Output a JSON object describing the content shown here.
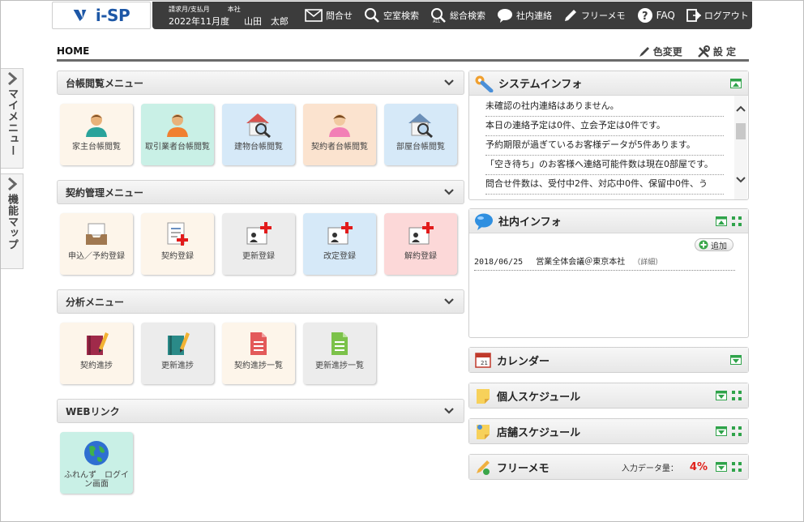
{
  "header": {
    "logo_text": "i-SP",
    "period_label": "請求月/支払月",
    "period_value": "2022年11月度",
    "branch_label": "本社",
    "user_name": "山田　太郎",
    "nav": [
      {
        "label": "問合せ",
        "icon": "mail-icon"
      },
      {
        "label": "空室検索",
        "icon": "search-icon"
      },
      {
        "label": "総合検索",
        "icon": "search-all-icon"
      },
      {
        "label": "社内連絡",
        "icon": "chat-icon"
      },
      {
        "label": "フリーメモ",
        "icon": "pencil-icon"
      },
      {
        "label": "FAQ",
        "icon": "question-icon"
      },
      {
        "label": "ログアウト",
        "icon": "logout-icon"
      }
    ]
  },
  "sidebar_tabs": [
    {
      "label": "マイメニュー"
    },
    {
      "label": "機能マップ"
    }
  ],
  "page": {
    "title": "HOME",
    "color_change": "色変更",
    "settings": "設 定"
  },
  "sections": [
    {
      "title": "台帳閲覧メニュー",
      "tiles": [
        {
          "label": "家主台帳閲覧",
          "icon": "owner-person-icon"
        },
        {
          "label": "取引業者台帳閲覧",
          "icon": "vendor-person-icon"
        },
        {
          "label": "建物台帳閲覧",
          "icon": "building-search-icon"
        },
        {
          "label": "契約者台帳閲覧",
          "icon": "tenant-person-icon"
        },
        {
          "label": "部屋台帳閲覧",
          "icon": "room-search-icon"
        }
      ]
    },
    {
      "title": "契約管理メニュー",
      "tiles": [
        {
          "label": "申込／予約登録",
          "icon": "inbox-tray-icon"
        },
        {
          "label": "契約登録",
          "icon": "document-add-icon"
        },
        {
          "label": "更新登録",
          "icon": "contract-add-icon"
        },
        {
          "label": "改定登録",
          "icon": "contract-add-icon"
        },
        {
          "label": "解約登録",
          "icon": "contract-add-icon"
        }
      ]
    },
    {
      "title": "分析メニュー",
      "tiles": [
        {
          "label": "契約進捗",
          "icon": "notebook-pencil-icon"
        },
        {
          "label": "更新進捗",
          "icon": "notebook-pencil-icon"
        },
        {
          "label": "契約進捗一覧",
          "icon": "document-red-icon"
        },
        {
          "label": "更新進捗一覧",
          "icon": "document-green-icon"
        }
      ]
    },
    {
      "title": "WEBリンク",
      "tiles": [
        {
          "label": "ふれんず　ログイン画面",
          "icon": "globe-icon"
        }
      ]
    }
  ],
  "panels": {
    "system_info": {
      "title": "システムインフォ",
      "rows": [
        "未確認の社内連絡はありません。",
        "本日の連絡予定は0件、立会予定は0件です。",
        "予約期限が過ぎているお客様データが5件あります。",
        "「空き待ち」のお客様へ連絡可能件数は現在0部屋です。",
        "問合せ件数は、受付中2件、対応中0件、保留中0件、う"
      ]
    },
    "company_info": {
      "title": "社内インフォ",
      "add_label": "追加",
      "news_date": "2018/06/25",
      "news_text": "営業全体会議＠東京本社",
      "news_detail": "（詳細）"
    },
    "calendar": {
      "title": "カレンダー"
    },
    "personal_schedule": {
      "title": "個人スケジュール"
    },
    "store_schedule": {
      "title": "店舗スケジュール"
    },
    "free_memo": {
      "title": "フリーメモ",
      "data_label": "入力データ量：",
      "data_value": "4%"
    }
  },
  "colors": {
    "topbar": "#3c3c3c",
    "brand_blue": "#1d57a6",
    "accent_green": "#2fa34a",
    "alert_red": "#e0201a"
  }
}
